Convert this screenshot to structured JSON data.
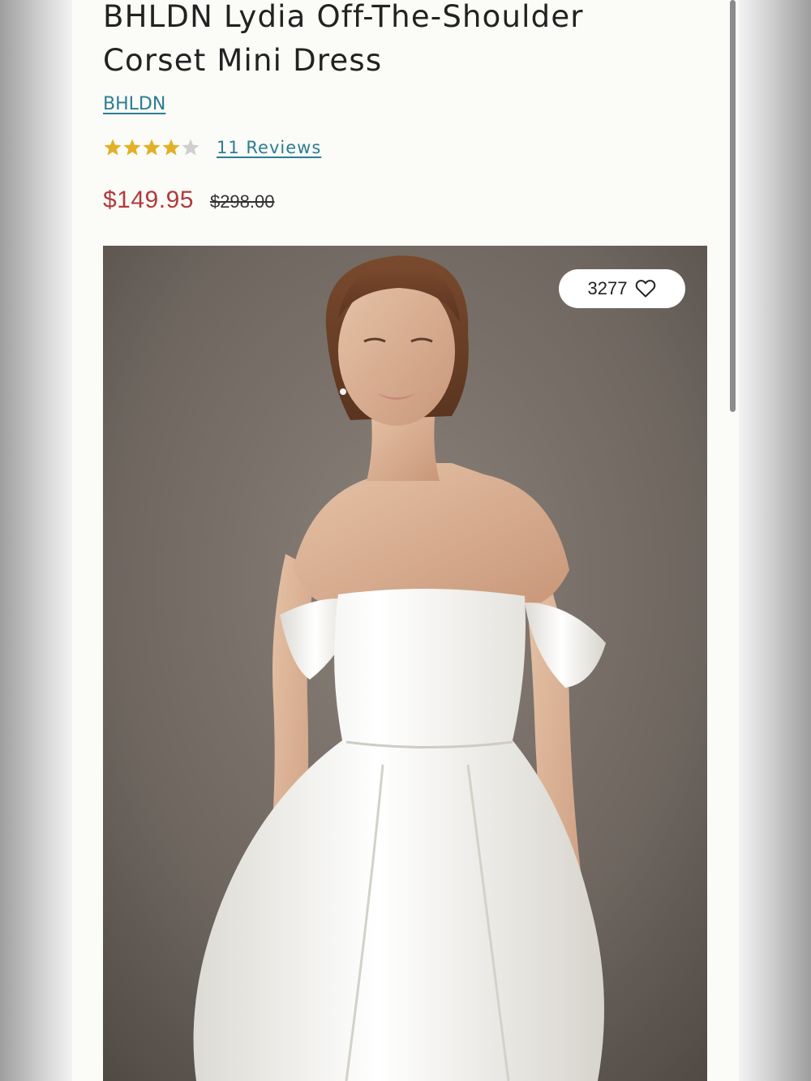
{
  "product": {
    "title": "BHLDN Lydia Off-The-Shoulder Corset Mini Dress",
    "brand": "BHLDN",
    "rating": 4,
    "rating_max": 5,
    "reviews_label": "11 Reviews",
    "sale_price": "$149.95",
    "original_price": "$298.00"
  },
  "gallery": {
    "favorites_count": "3277",
    "favorite_icon": "heart-outline-icon"
  },
  "colors": {
    "link": "#2b7e91",
    "sale_price": "#b23a3a",
    "star_filled": "#e2b127",
    "star_empty": "#cfcfcf"
  }
}
